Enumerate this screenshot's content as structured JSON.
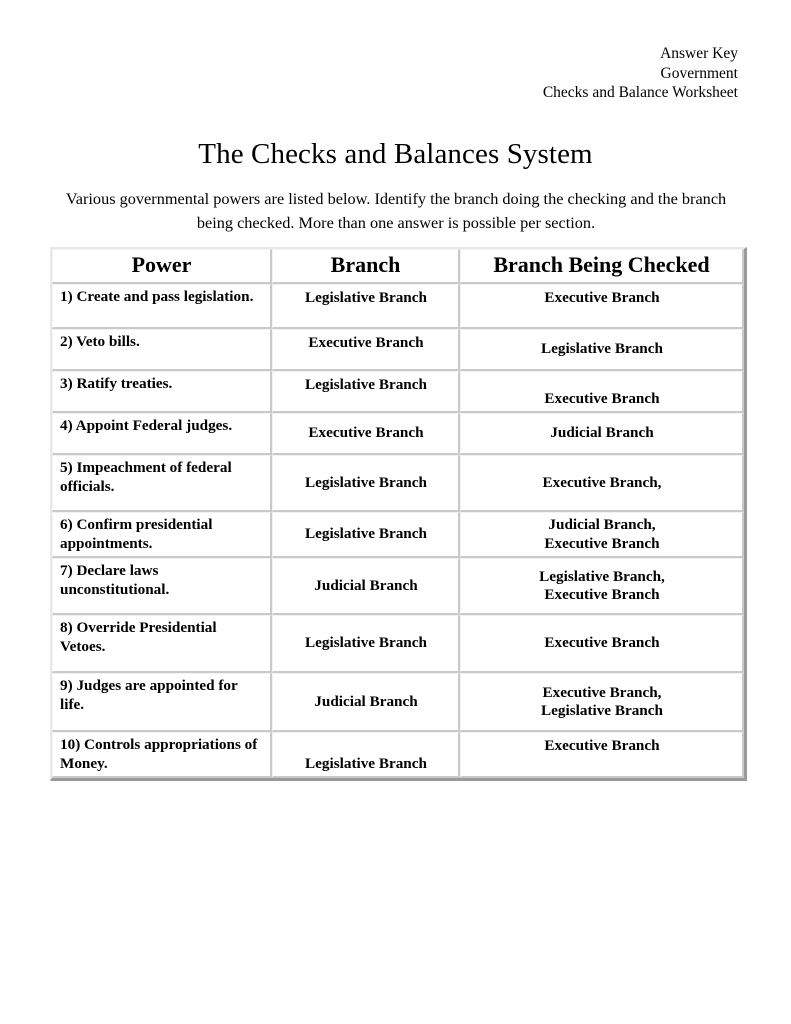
{
  "header": {
    "line1": "Answer Key",
    "line2": "Government",
    "line3": "Checks and Balance Worksheet"
  },
  "title": "The Checks and Balances System",
  "instructions": "Various governmental powers are listed below. Identify the branch doing the checking and the branch being checked. More than one answer is possible per section.",
  "table": {
    "columns": {
      "power": "Power",
      "branch": "Branch",
      "checked": "Branch Being Checked"
    },
    "rows": [
      {
        "power": "1) Create and pass legislation.",
        "branch_l1": "Legislative Branch",
        "branch_l2": "",
        "checked_l1": "Executive Branch",
        "checked_l2": ""
      },
      {
        "power": "2) Veto bills.",
        "branch_l1": "Executive Branch",
        "branch_l2": "",
        "checked_l1": "Legislative Branch",
        "checked_l2": ""
      },
      {
        "power": "3) Ratify treaties.",
        "branch_l1": "Legislative Branch",
        "branch_l2": "",
        "checked_l1": "Executive Branch",
        "checked_l2": ""
      },
      {
        "power": "4) Appoint Federal judges.",
        "branch_l1": "Executive Branch",
        "branch_l2": "",
        "checked_l1": "Judicial Branch",
        "checked_l2": ""
      },
      {
        "power": "5) Impeachment of federal officials.",
        "branch_l1": "Legislative Branch",
        "branch_l2": "",
        "checked_l1": "Executive Branch,",
        "checked_l2": ""
      },
      {
        "power": "6) Confirm presidential appointments.",
        "branch_l1": "Legislative Branch",
        "branch_l2": "",
        "checked_l1": "Judicial Branch,",
        "checked_l2": "Executive Branch"
      },
      {
        "power": "7) Declare laws unconstitutional.",
        "branch_l1": "Judicial Branch",
        "branch_l2": "",
        "checked_l1": "Legislative Branch,",
        "checked_l2": "Executive Branch"
      },
      {
        "power": "8) Override Presidential Vetoes.",
        "branch_l1": "Legislative Branch",
        "branch_l2": "",
        "checked_l1": "Executive Branch",
        "checked_l2": ""
      },
      {
        "power": "9) Judges are appointed for life.",
        "branch_l1": "Judicial Branch",
        "branch_l2": "",
        "checked_l1": "Executive Branch,",
        "checked_l2": "Legislative Branch"
      },
      {
        "power": "10) Controls appropriations of Money.",
        "branch_l1": "Legislative Branch",
        "branch_l2": "",
        "checked_l1": "Executive Branch",
        "checked_l2": ""
      }
    ]
  }
}
